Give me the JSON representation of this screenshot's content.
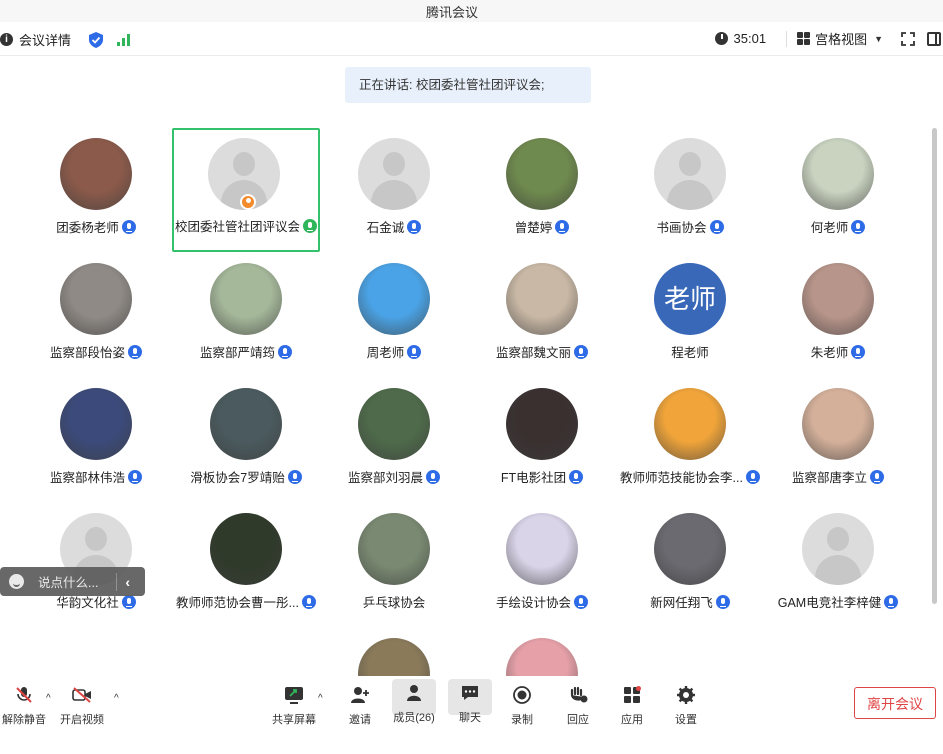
{
  "app": {
    "title": "腾讯会议"
  },
  "infobar": {
    "meeting_details": "会议详情",
    "timer": "35:01",
    "view_mode": "宫格视图"
  },
  "speaking": "正在讲话: 校团委社管社团评议会;",
  "participants": [
    {
      "name": "团委杨老师",
      "avatar": "photo",
      "color": "#8b5a4a",
      "mic": "on"
    },
    {
      "name": "校团委社管社团评议会",
      "avatar": "placeholder",
      "mic": "speaking",
      "active": true,
      "host": true
    },
    {
      "name": "石金诚",
      "avatar": "placeholder",
      "mic": "on"
    },
    {
      "name": "曾楚婷",
      "avatar": "photo",
      "color": "#6f8a4e",
      "mic": "on"
    },
    {
      "name": "书画协会",
      "avatar": "placeholder",
      "mic": "on"
    },
    {
      "name": "何老师",
      "avatar": "photo",
      "color": "#c9d3c0",
      "mic": "on"
    },
    {
      "name": "监察部段怡姿",
      "avatar": "photo",
      "color": "#8f8a85",
      "mic": "on"
    },
    {
      "name": "监察部严靖筠",
      "avatar": "photo",
      "color": "#a5b89a",
      "mic": "on"
    },
    {
      "name": "周老师",
      "avatar": "photo",
      "color": "#4aa3e6",
      "mic": "on"
    },
    {
      "name": "监察部魏文丽",
      "avatar": "photo",
      "color": "#c9b8a5",
      "mic": "on"
    },
    {
      "name": "程老师",
      "avatar": "text",
      "avatar_text": "老师"
    },
    {
      "name": "朱老师",
      "avatar": "photo",
      "color": "#b8958a",
      "mic": "on"
    },
    {
      "name": "监察部林伟浩",
      "avatar": "photo",
      "color": "#3b4a7a",
      "mic": "on"
    },
    {
      "name": "滑板协会7罗靖贻",
      "avatar": "photo",
      "color": "#4a5a5e",
      "mic": "on"
    },
    {
      "name": "监察部刘羽晨",
      "avatar": "photo",
      "color": "#4e6a4a",
      "mic": "on"
    },
    {
      "name": "FT电影社团",
      "avatar": "photo",
      "color": "#3a3030",
      "mic": "on"
    },
    {
      "name": "教师师范技能协会李...",
      "avatar": "photo",
      "color": "#f0a43a",
      "mic": "on"
    },
    {
      "name": "监察部唐李立",
      "avatar": "photo",
      "color": "#d4b09a",
      "mic": "on"
    },
    {
      "name": "华韵文化社",
      "avatar": "placeholder",
      "mic": "on"
    },
    {
      "name": "教师师范协会曹一彤...",
      "avatar": "photo",
      "color": "#2f3a2a",
      "mic": "on"
    },
    {
      "name": "乒乓球协会",
      "avatar": "photo",
      "color": "#7a8a72",
      "mic": "none"
    },
    {
      "name": "手绘设计协会",
      "avatar": "photo",
      "color": "#d9d4e8",
      "mic": "on"
    },
    {
      "name": "新网任翔飞",
      "avatar": "photo",
      "color": "#6a6a70",
      "mic": "on"
    },
    {
      "name": "GAM电竞社李梓健",
      "avatar": "placeholder",
      "mic": "on"
    },
    {
      "name": "",
      "avatar": "photo",
      "color": "#8a7a5a",
      "mic": "none"
    },
    {
      "name": "",
      "avatar": "photo",
      "color": "#e6a0a8",
      "mic": "none"
    }
  ],
  "chat_tip": {
    "placeholder": "说点什么..."
  },
  "toolbar": {
    "items": [
      {
        "label": "解除静音",
        "icon": "mic-muted-icon"
      },
      {
        "label": "开启视频",
        "icon": "camera-off-icon"
      },
      {
        "label": "共享屏幕",
        "icon": "share-screen-icon"
      },
      {
        "label": "邀请",
        "icon": "invite-icon"
      },
      {
        "label": "成员(26)",
        "icon": "members-icon"
      },
      {
        "label": "聊天",
        "icon": "chat-icon"
      },
      {
        "label": "录制",
        "icon": "record-icon"
      },
      {
        "label": "回应",
        "icon": "reaction-icon"
      },
      {
        "label": "应用",
        "icon": "apps-icon"
      },
      {
        "label": "设置",
        "icon": "settings-icon"
      }
    ],
    "leave": "离开会议"
  }
}
